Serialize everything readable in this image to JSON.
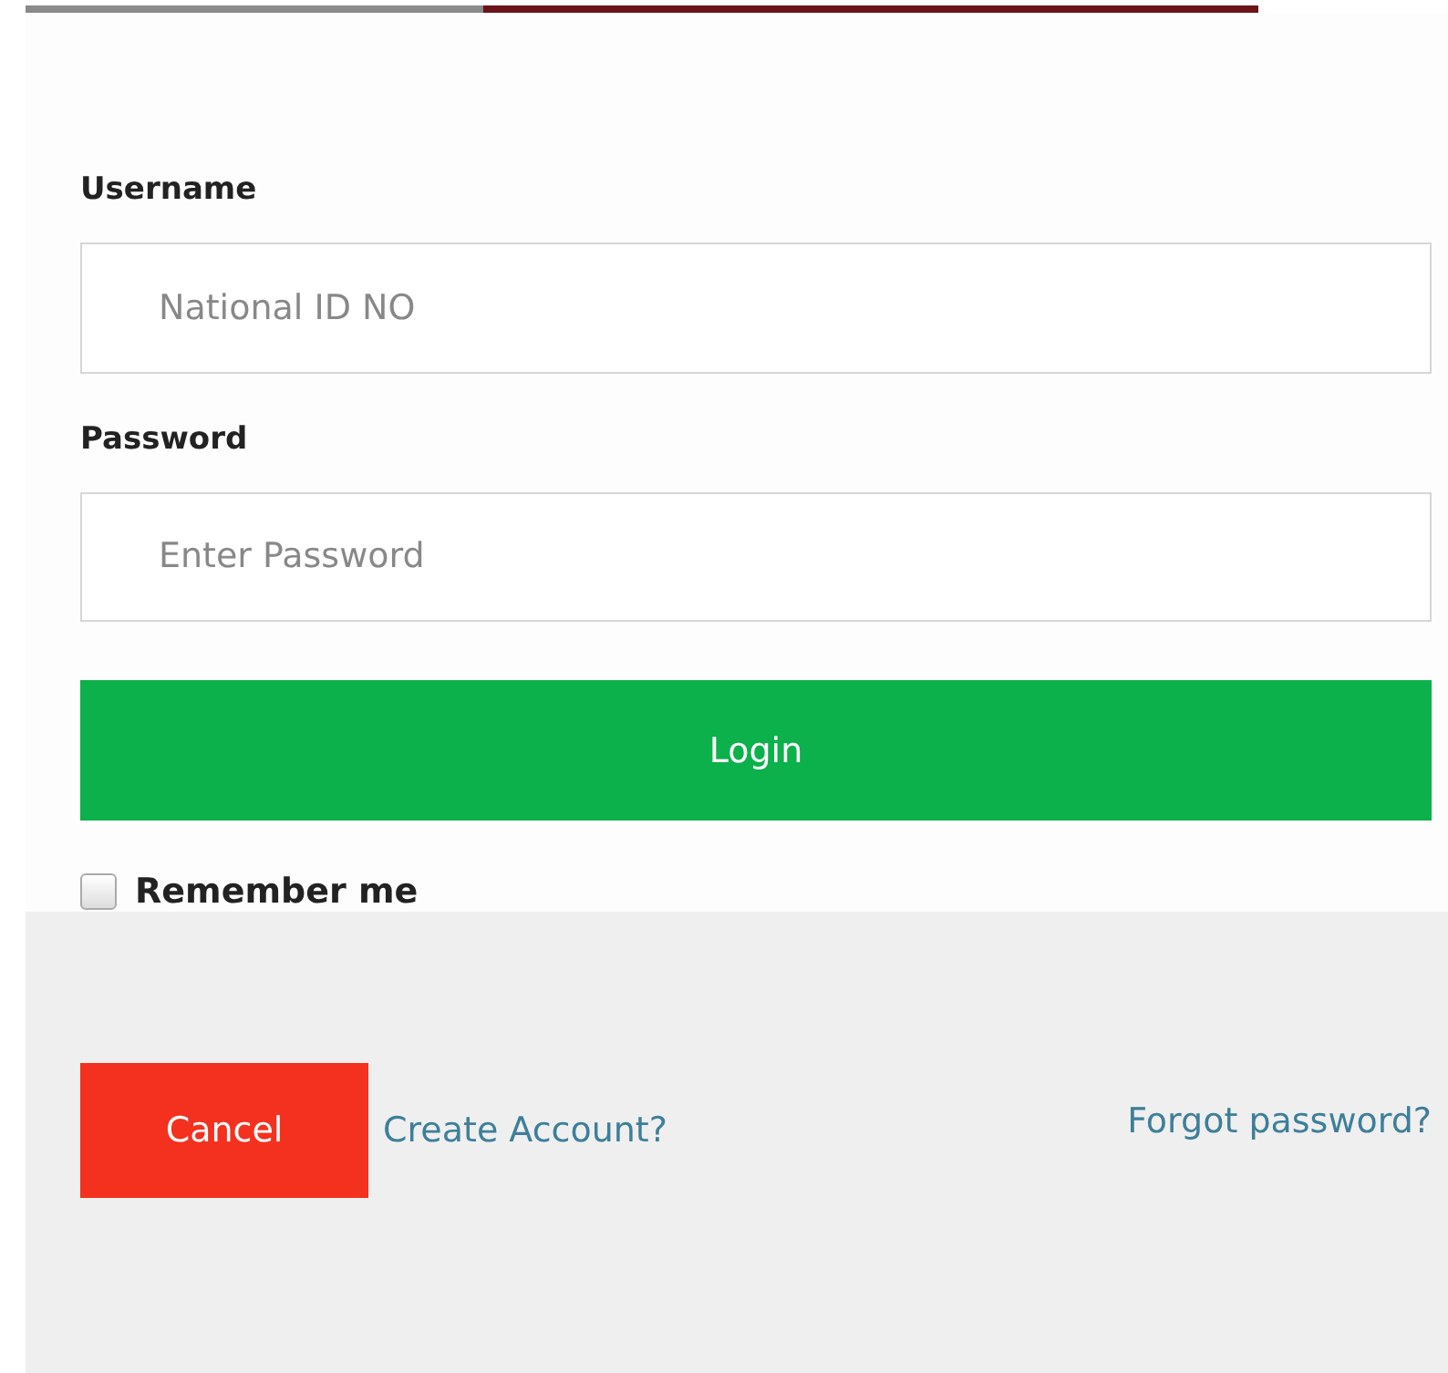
{
  "form": {
    "username": {
      "label": "Username",
      "placeholder": "National ID NO"
    },
    "password": {
      "label": "Password",
      "placeholder": "Enter Password"
    },
    "login_button": "Login",
    "remember": {
      "label": "Remember me",
      "checked": false
    }
  },
  "footer": {
    "cancel_button": "Cancel",
    "create_account_link": "Create Account?",
    "forgot_password_link": "Forgot password?"
  }
}
